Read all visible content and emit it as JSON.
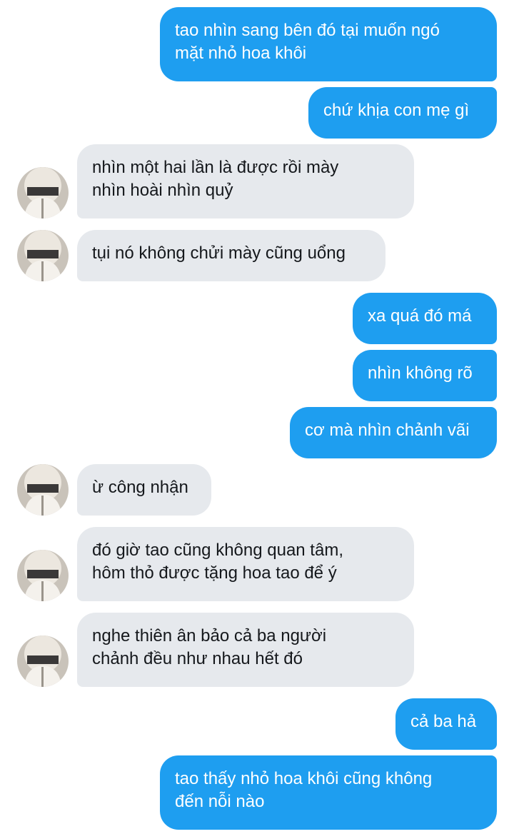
{
  "messages": [
    {
      "side": "out",
      "text": "tao nhìn sang bên đó tại muốn ngó\nmặt nhỏ hoa khôi"
    },
    {
      "side": "out",
      "text": "chứ khịa con mẹ gì"
    },
    {
      "side": "in",
      "text": "nhìn một hai lần là được rồi mày\nnhìn hoài nhìn quỷ"
    },
    {
      "side": "in",
      "text": "tụi nó không chửi mày cũng uổng"
    },
    {
      "side": "out",
      "text": "xa quá đó má"
    },
    {
      "side": "out",
      "text": "nhìn không rõ"
    },
    {
      "side": "out",
      "text": "cơ mà nhìn chảnh vãi"
    },
    {
      "side": "in",
      "text": "ừ công nhận"
    },
    {
      "side": "in",
      "text": "đó giờ tao cũng không quan tâm,\nhôm thỏ được tặng hoa tao để ý"
    },
    {
      "side": "in",
      "text": "nghe thiên ân bảo cả ba người\nchảnh đều như nhau hết đó"
    },
    {
      "side": "out",
      "text": "cả ba hả"
    },
    {
      "side": "out",
      "text": "tao thấy nhỏ hoa khôi cũng không\nđến nỗi nào"
    }
  ],
  "colors": {
    "outgoing_bubble": "#1e9ef0",
    "incoming_bubble": "#e6e9ed",
    "outgoing_text": "#ffffff",
    "incoming_text": "#15181c"
  },
  "avatar_icon": "user-avatar-photo"
}
